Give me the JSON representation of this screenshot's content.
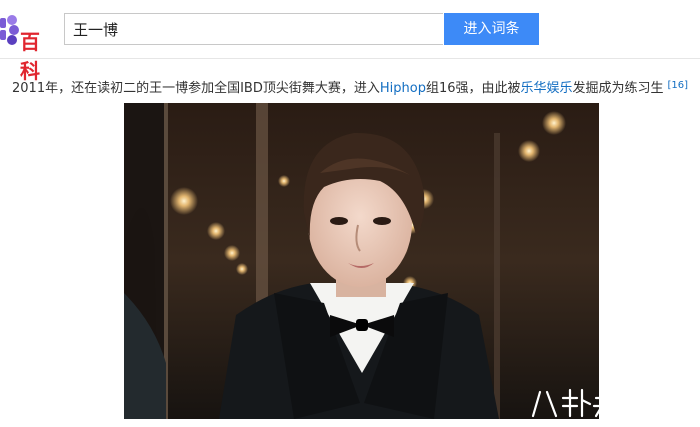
{
  "logo": {
    "text": "百科"
  },
  "search": {
    "value": "王一博",
    "button_label": "进入词条"
  },
  "paragraph": {
    "part1": "2011年，还在读初二的王一博参加全国IBD顶尖街舞大赛，进入",
    "link1": "Hiphop",
    "part2": "组16强，由此被",
    "link2": "乐华娱乐",
    "part3": "发掘成为练习生",
    "citation": "[16]"
  },
  "watermark": {
    "text": "八卦先生"
  },
  "colors": {
    "accent": "#3d8af7",
    "link": "#136ec2",
    "logo_red": "#e0262f",
    "logo_purple": "#7b5cd6"
  }
}
